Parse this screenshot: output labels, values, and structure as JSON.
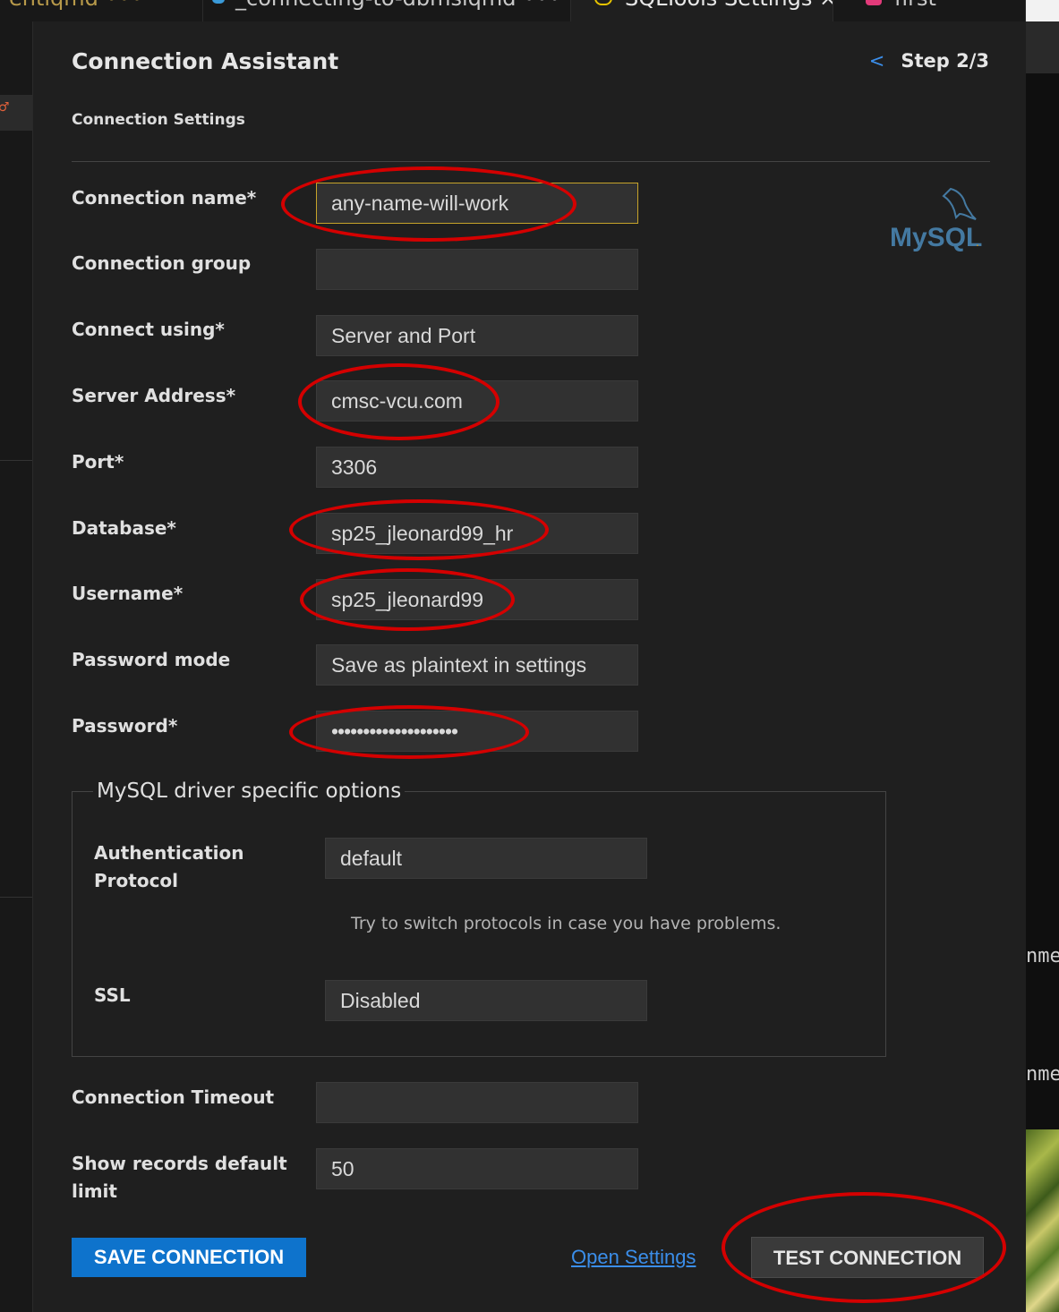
{
  "tabs": [
    {
      "label": "entiqmd •••"
    },
    {
      "label": "_connecting-to-dbmsiqmd •••"
    },
    {
      "label": "SQLTools Settings ×"
    },
    {
      "label": "first"
    }
  ],
  "right_code": [
    "nme",
    "nme"
  ],
  "header": {
    "title": "Connection Assistant",
    "back_symbol": "<",
    "step": "Step 2/3",
    "section": "Connection Settings"
  },
  "logo": {
    "text": "MySQL",
    "trademark": "."
  },
  "fields": [
    {
      "label": "Connection name*",
      "value": "any-name-will-work"
    },
    {
      "label": "Connection group",
      "value": ""
    },
    {
      "label": "Connect using*",
      "value": "Server and Port"
    },
    {
      "label": "Server Address*",
      "value": "cmsc-vcu.com"
    },
    {
      "label": "Port*",
      "value": "3306"
    },
    {
      "label": "Database*",
      "value": "sp25_jleonard99_hr"
    },
    {
      "label": "Username*",
      "value": "sp25_jleonard99"
    },
    {
      "label": "Password mode",
      "value": "Save as plaintext in settings"
    },
    {
      "label": "Password*",
      "value": "••••••••••••••••••••"
    }
  ],
  "driver": {
    "legend": "MySQL driver specific options",
    "auth_label_1": "Authentication",
    "auth_label_2": "Protocol",
    "auth_value": "default",
    "hint": "Try to switch protocols in case you have problems.",
    "ssl_label": "SSL",
    "ssl_value": "Disabled"
  },
  "extra": {
    "timeout_label": "Connection Timeout",
    "timeout_value": "",
    "records_label_1": "Show records default",
    "records_label_2": "limit",
    "records_value": "50"
  },
  "actions": {
    "save": "SAVE CONNECTION",
    "open_settings": "Open Settings",
    "test": "TEST CONNECTION"
  },
  "colors": {
    "accent": "#0e73cc",
    "link": "#3b8eea",
    "annotation": "#d40000",
    "focus_border": "#c6a32a"
  }
}
